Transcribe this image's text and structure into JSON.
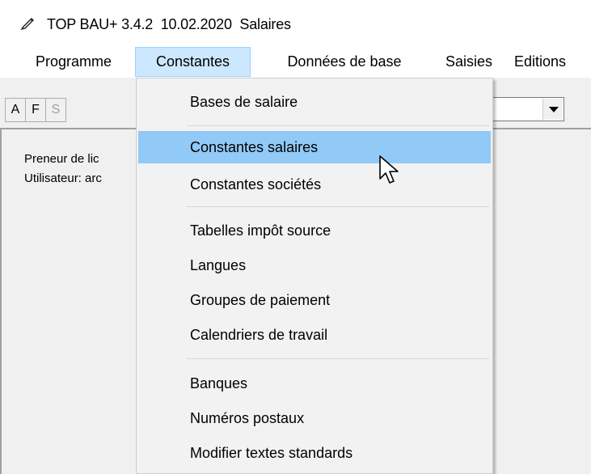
{
  "window": {
    "title": "TOP BAU+ 3.4.2  10.02.2020  Salaires",
    "icon": "pen-app-icon"
  },
  "menubar": {
    "items": [
      {
        "label": "Programme"
      },
      {
        "label": "Constantes"
      },
      {
        "label": "Données de base"
      },
      {
        "label": "Saisies"
      },
      {
        "label": "Editions"
      }
    ],
    "active": "Constantes"
  },
  "toolbar": {
    "buttons": [
      {
        "label": "A",
        "enabled": true
      },
      {
        "label": "F",
        "enabled": true
      },
      {
        "label": "S",
        "enabled": false
      }
    ],
    "dropdown_value": ""
  },
  "content": {
    "lines": [
      "Preneur de lic",
      "Utilisateur: arc"
    ]
  },
  "constantes_menu": {
    "groups": [
      [
        "Bases de salaire"
      ],
      [
        "Constantes salaires",
        "Constantes sociétés"
      ],
      [
        "Tabelles impôt source",
        "Langues",
        "Groupes de paiement",
        "Calendriers de travail"
      ],
      [
        "Banques",
        "Numéros postaux",
        "Modifier textes standards"
      ]
    ],
    "highlighted": "Constantes salaires"
  },
  "colors": {
    "menu_active_bg": "#cce8ff",
    "menu_item_highlight": "#91c9f7",
    "window_bg": "#f0f0f0"
  }
}
